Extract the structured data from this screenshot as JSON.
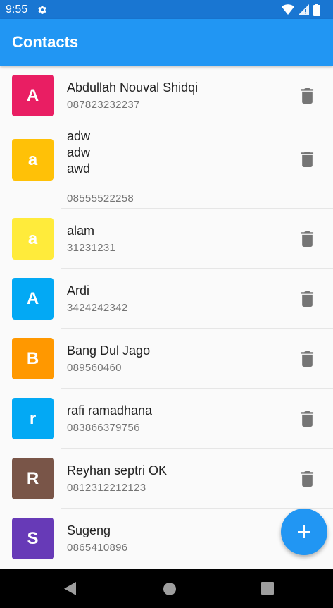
{
  "status": {
    "time": "9:55"
  },
  "app_bar": {
    "title": "Contacts"
  },
  "colors": {
    "status_bar": "#1976d2",
    "app_bar": "#2196f3",
    "fab": "#2196f3"
  },
  "contacts": [
    {
      "initial": "A",
      "name": "Abdullah Nouval Shidqi",
      "phone": "087823232237",
      "color": "#e91e63"
    },
    {
      "initial": "a",
      "name": "adw\nadw\nawd",
      "phone": "08555522258",
      "color": "#ffc107"
    },
    {
      "initial": "a",
      "name": "alam",
      "phone": "31231231",
      "color": "#ffeb3b"
    },
    {
      "initial": "A",
      "name": "Ardi",
      "phone": "3424242342",
      "color": "#03a9f4"
    },
    {
      "initial": "B",
      "name": "Bang Dul Jago",
      "phone": "089560460",
      "color": "#ff9800"
    },
    {
      "initial": "r",
      "name": "rafi ramadhana",
      "phone": "083866379756",
      "color": "#03a9f4"
    },
    {
      "initial": "R",
      "name": "Reyhan septri OK",
      "phone": "0812312212123",
      "color": "#795548"
    },
    {
      "initial": "S",
      "name": "Sugeng",
      "phone": "0865410896",
      "color": "#673ab7"
    }
  ],
  "icons": {
    "status_settings": "gear-icon",
    "wifi": "wifi-icon",
    "signal": "signal-icon",
    "battery": "battery-icon",
    "delete": "trash-icon",
    "fab": "plus-icon",
    "nav_back": "back-triangle-icon",
    "nav_home": "home-circle-icon",
    "nav_recents": "recents-square-icon"
  }
}
